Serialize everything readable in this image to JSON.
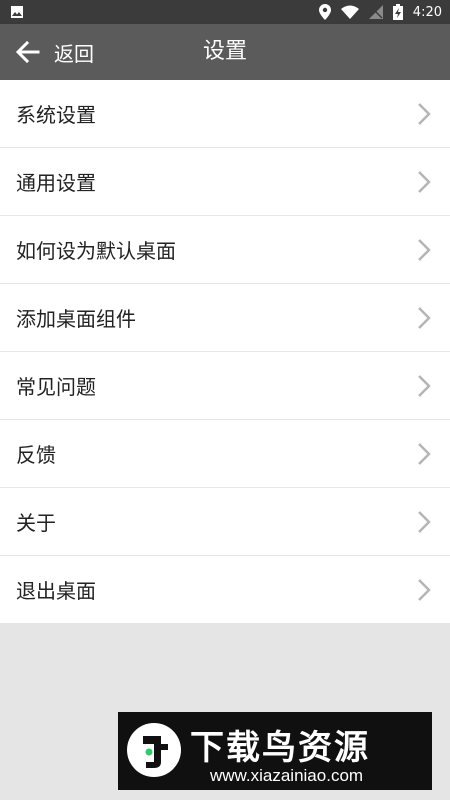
{
  "status_bar": {
    "time": "4:20"
  },
  "app_bar": {
    "back_label": "返回",
    "title": "设置"
  },
  "menu": {
    "items": [
      {
        "label": "系统设置"
      },
      {
        "label": "通用设置"
      },
      {
        "label": "如何设为默认桌面"
      },
      {
        "label": "添加桌面组件"
      },
      {
        "label": "常见问题"
      },
      {
        "label": "反馈"
      },
      {
        "label": "关于"
      },
      {
        "label": "退出桌面"
      }
    ]
  },
  "watermark": {
    "brand": "下载鸟资源",
    "url": "www.xiazainiao.com"
  },
  "colors": {
    "status_bar": "#3b3b3b",
    "app_bar": "#5b5b5b",
    "background": "#e5e5e5",
    "chevron": "#b5b5b5"
  }
}
